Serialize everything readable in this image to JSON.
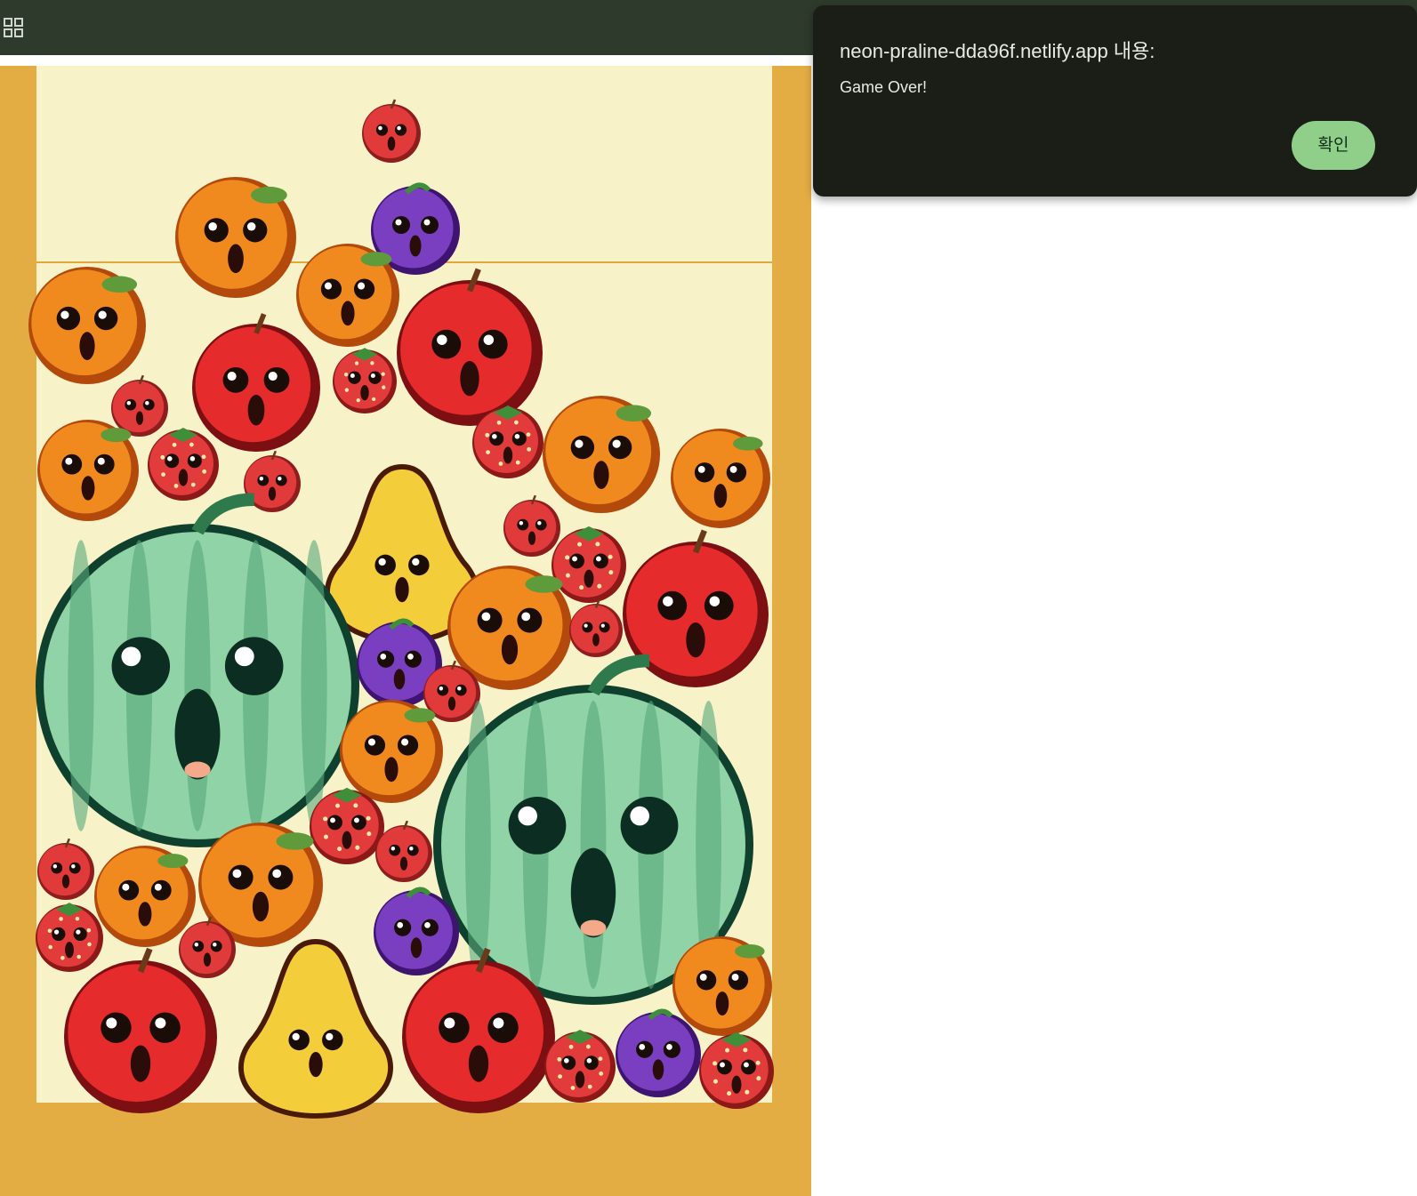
{
  "toolbar": {
    "apps_icon": "apps-grid-icon",
    "background_color": "#2e3a2c"
  },
  "game": {
    "frame_color": "#e3ad44",
    "play_area_color": "#f7f2c8",
    "next_fruit": "cherry",
    "fruits": [
      {
        "kind": "cherry"
      },
      {
        "kind": "orange"
      },
      {
        "kind": "grape"
      },
      {
        "kind": "orange"
      },
      {
        "kind": "orange"
      },
      {
        "kind": "apple"
      },
      {
        "kind": "apple"
      },
      {
        "kind": "strawberry"
      },
      {
        "kind": "cherry"
      },
      {
        "kind": "orange"
      },
      {
        "kind": "strawberry"
      },
      {
        "kind": "cherry"
      },
      {
        "kind": "strawberry"
      },
      {
        "kind": "orange"
      },
      {
        "kind": "orange"
      },
      {
        "kind": "pear"
      },
      {
        "kind": "watermelon"
      },
      {
        "kind": "cherry"
      },
      {
        "kind": "strawberry"
      },
      {
        "kind": "apple"
      },
      {
        "kind": "orange"
      },
      {
        "kind": "cherry"
      },
      {
        "kind": "grape"
      },
      {
        "kind": "cherry"
      },
      {
        "kind": "orange"
      },
      {
        "kind": "watermelon"
      },
      {
        "kind": "strawberry"
      },
      {
        "kind": "cherry"
      },
      {
        "kind": "cherry"
      },
      {
        "kind": "orange"
      },
      {
        "kind": "orange"
      },
      {
        "kind": "strawberry"
      },
      {
        "kind": "cherry"
      },
      {
        "kind": "grape"
      },
      {
        "kind": "apple"
      },
      {
        "kind": "pear"
      },
      {
        "kind": "apple"
      },
      {
        "kind": "orange"
      },
      {
        "kind": "strawberry"
      },
      {
        "kind": "grape"
      },
      {
        "kind": "strawberry"
      }
    ]
  },
  "dialog": {
    "title": "neon-praline-dda96f.netlify.app 내용:",
    "message": "Game Over!",
    "ok_label": "확인",
    "ok_color": "#8fcf8a"
  }
}
